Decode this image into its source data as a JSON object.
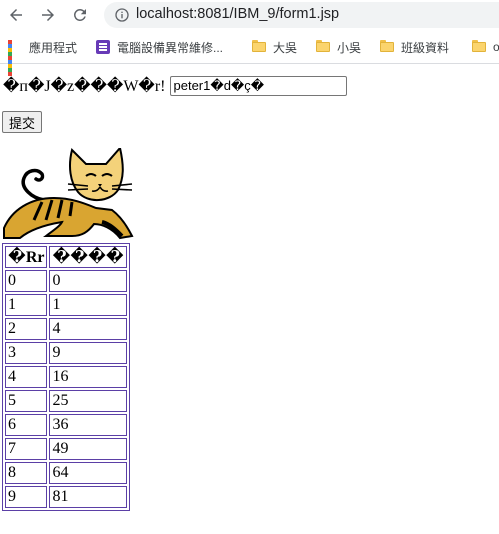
{
  "browser": {
    "url": "localhost:8081/IBM_9/form1.jsp",
    "bookmarks": [
      {
        "label": "應用程式",
        "icon": "apps-grid-icon"
      },
      {
        "label": "電腦設備異常維修...",
        "icon": "form-page-icon"
      },
      {
        "label": "大吳",
        "icon": "folder-icon"
      },
      {
        "label": "小吳",
        "icon": "folder-icon"
      },
      {
        "label": "班級資料",
        "icon": "folder-icon"
      },
      {
        "label": "o",
        "icon": "folder-icon"
      }
    ]
  },
  "page": {
    "prompt_label": "�п�J�z���W�r!",
    "name_value": "peter1�d�ç�",
    "submit_label": "提交",
    "image": "tomcat-logo"
  },
  "table": {
    "headers": [
      "�Rr",
      "����"
    ],
    "rows": [
      [
        "0",
        "0"
      ],
      [
        "1",
        "1"
      ],
      [
        "2",
        "4"
      ],
      [
        "3",
        "9"
      ],
      [
        "4",
        "16"
      ],
      [
        "5",
        "25"
      ],
      [
        "6",
        "36"
      ],
      [
        "7",
        "49"
      ],
      [
        "8",
        "64"
      ],
      [
        "9",
        "81"
      ]
    ]
  },
  "colors": {
    "table_border": "#5b3fa6",
    "omnibox_bg": "#f1f3f4",
    "folder": "#fbd46d"
  }
}
